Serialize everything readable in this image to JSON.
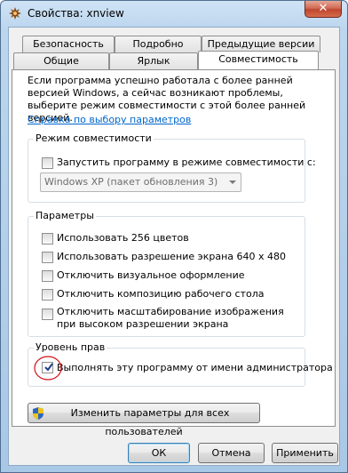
{
  "window": {
    "title": "Свойства: xnview",
    "close_glyph": "✕"
  },
  "tabs_row1": [
    "Безопасность",
    "Подробно",
    "Предыдущие версии"
  ],
  "tabs_row2": [
    "Общие",
    "Ярлык",
    "Совместимость"
  ],
  "active_tab": "Совместимость",
  "description": "Если программа успешно работала с более ранней версией Windows, а сейчас возникают проблемы, выберите режим совместимости с этой более ранней версией.",
  "help_link": "Справка по выбору параметров",
  "compat_group": {
    "title": "Режим совместимости",
    "checkbox_label": "Запустить программу в режиме совместимости с:",
    "checked": false,
    "combo_value": "Windows XP (пакет обновления 3)"
  },
  "settings_group": {
    "title": "Параметры",
    "items": [
      {
        "label": "Использовать 256 цветов",
        "checked": false
      },
      {
        "label": "Использовать разрешение экрана 640 x 480",
        "checked": false
      },
      {
        "label": "Отключить визуальное оформление",
        "checked": false
      },
      {
        "label": "Отключить композицию рабочего стола",
        "checked": false
      },
      {
        "label": "Отключить масштабирование изображения при высоком разрешении экрана",
        "checked": false
      }
    ]
  },
  "privilege_group": {
    "title": "Уровень прав",
    "checkbox_label": "Выполнять эту программу от имени администратора",
    "checked": true
  },
  "all_users_button": "Изменить параметры для всех пользователей",
  "footer_buttons": {
    "ok": "ОК",
    "cancel": "Отмена",
    "apply": "Применить"
  },
  "colors": {
    "link": "#0066cc",
    "annotation": "#d0101a",
    "close": "#c0462e"
  }
}
